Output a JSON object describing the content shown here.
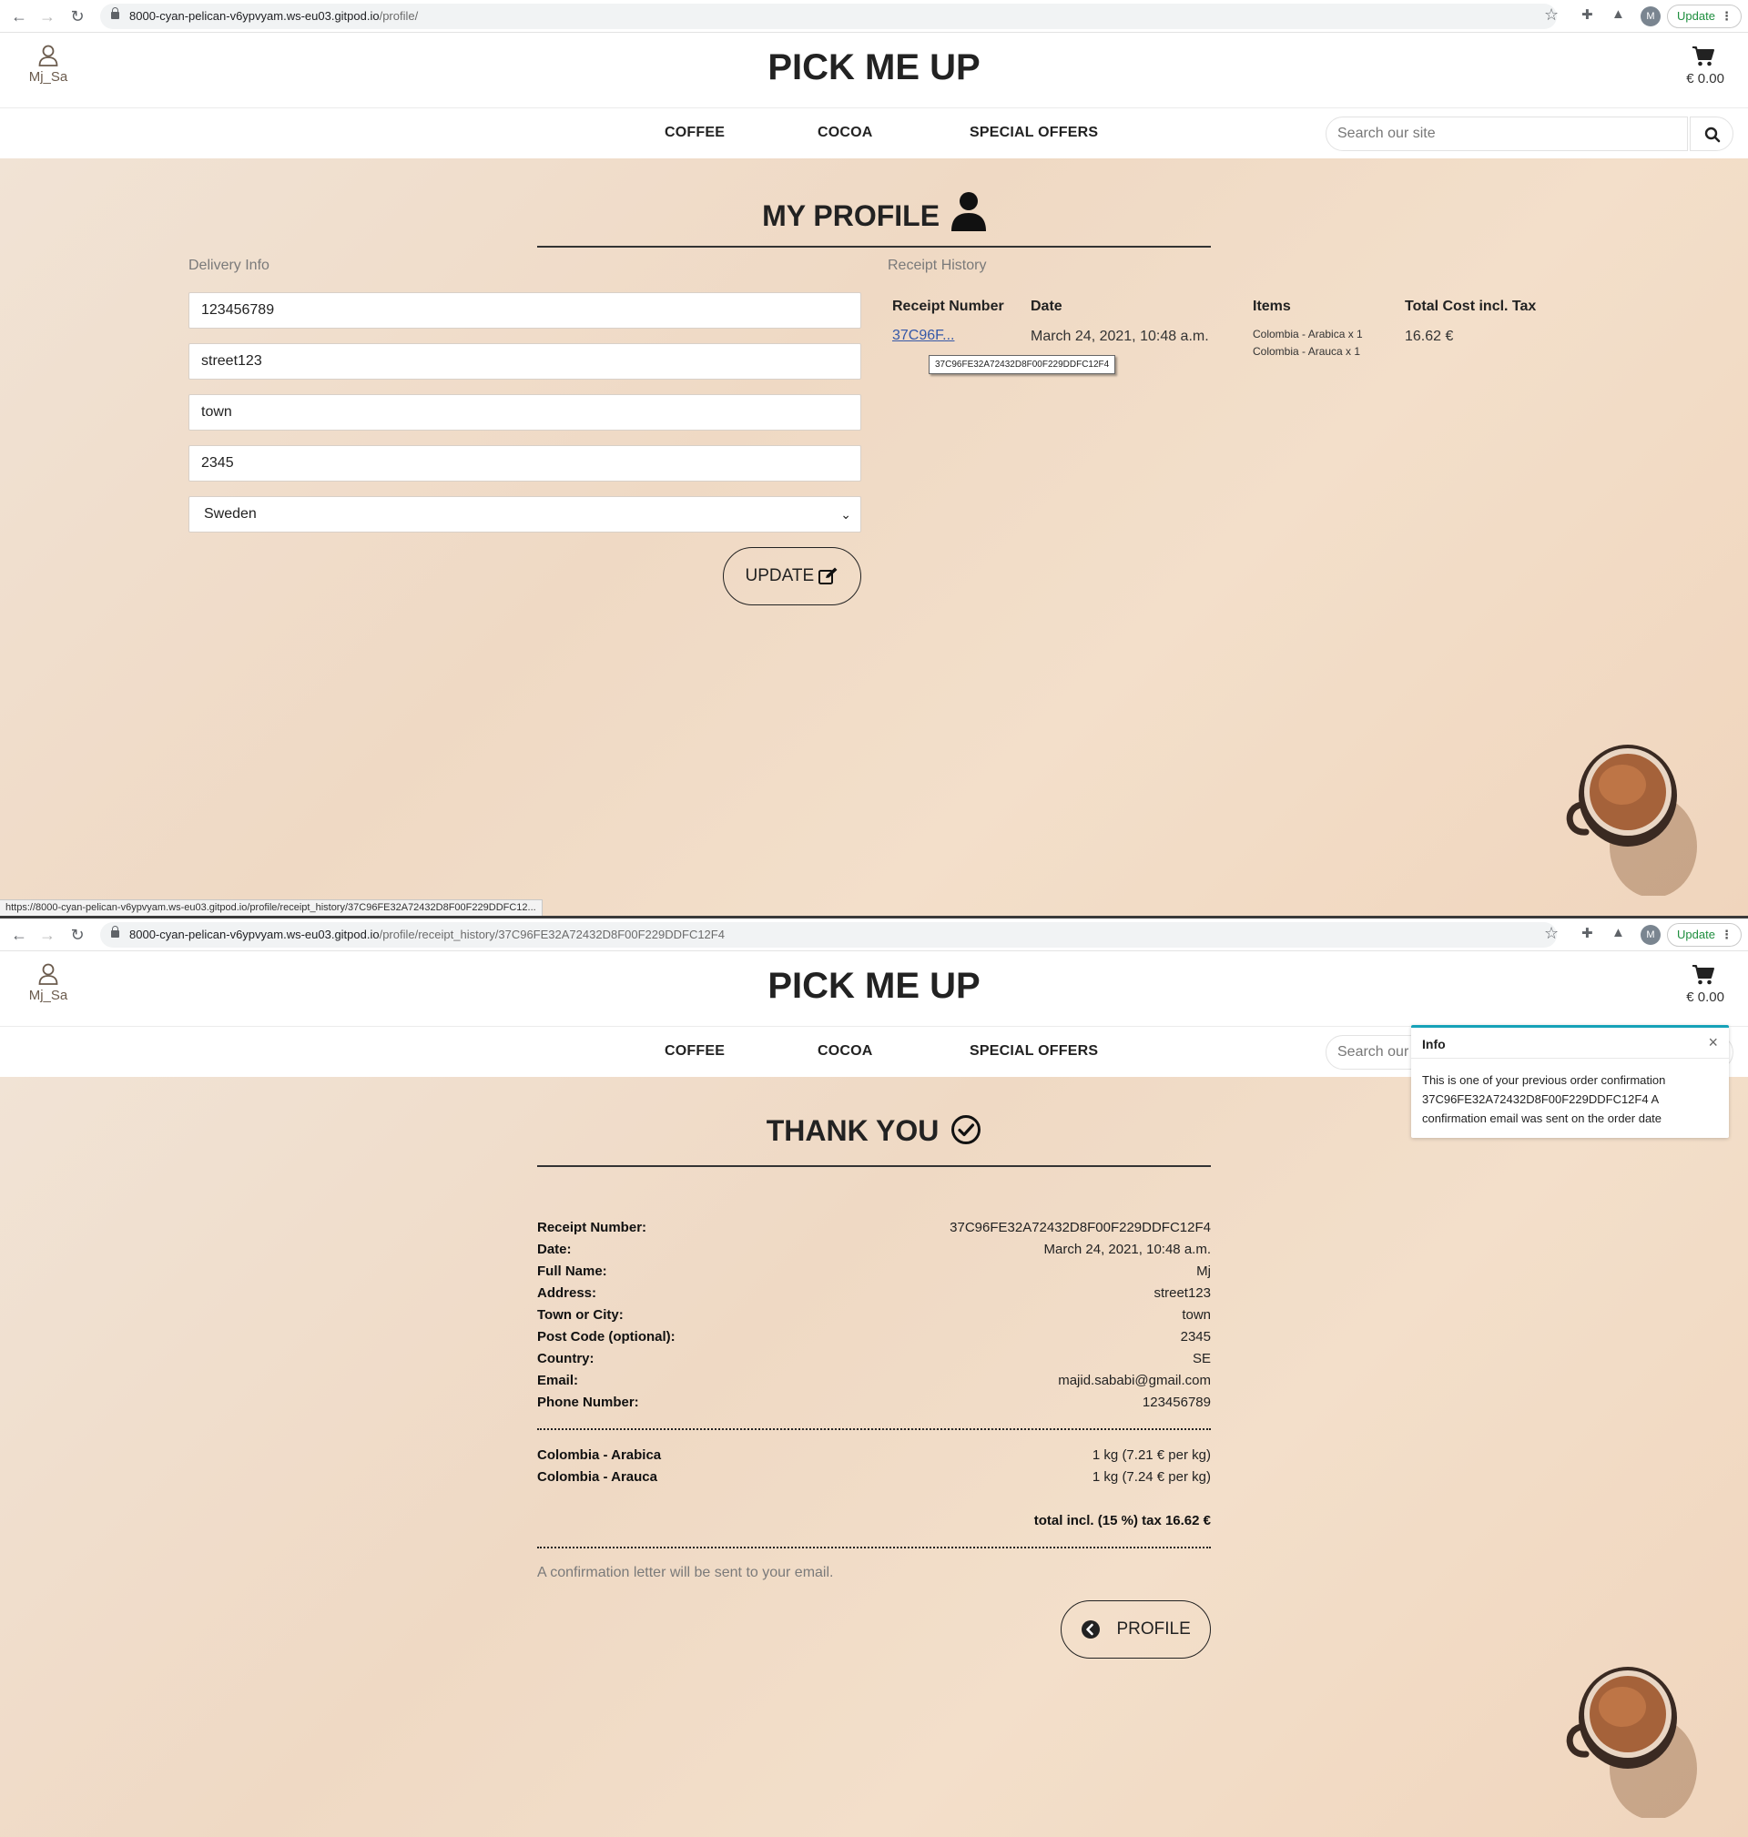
{
  "profile_screen": {
    "browser": {
      "url_host": "8000-cyan-pelican-v6ypvyam.ws-eu03.gitpod.io",
      "url_path": "/profile/",
      "avatar_letter": "M",
      "update_label": "Update"
    },
    "header": {
      "user_name": "Mj_Sa",
      "logo": "PICK ME UP",
      "cart_total": "€ 0.00"
    },
    "menu": {
      "coffee": "COFFEE",
      "cocoa": "COCOA",
      "special_offers": "SPECIAL OFFERS",
      "search_placeholder": "Search our site"
    },
    "title": "MY PROFILE",
    "delivery": {
      "label": "Delivery Info",
      "phone": "123456789",
      "street": "street123",
      "town": "town",
      "postcode": "2345",
      "country": "Sweden",
      "update_button": "UPDATE"
    },
    "receipt_history": {
      "label": "Receipt History",
      "headers": {
        "receipt_number": "Receipt Number",
        "date": "Date",
        "items": "Items",
        "total": "Total Cost incl. Tax"
      },
      "row": {
        "receipt_short": "37C96F...",
        "receipt_full": "37C96FE32A72432D8F00F229DDFC12F4",
        "date": "March 24, 2021, 10:48 a.m.",
        "item_1": "Colombia - Arabica x 1",
        "item_2": "Colombia - Arauca x 1",
        "total": "16.62 €"
      }
    },
    "status_url": "https://8000-cyan-pelican-v6ypvyam.ws-eu03.gitpod.io/profile/receipt_history/37C96FE32A72432D8F00F229DDFC12..."
  },
  "receipt_screen": {
    "browser": {
      "url_host": "8000-cyan-pelican-v6ypvyam.ws-eu03.gitpod.io",
      "url_path": "/profile/receipt_history/37C96FE32A72432D8F00F229DDFC12F4",
      "avatar_letter": "M",
      "update_label": "Update"
    },
    "header": {
      "user_name": "Mj_Sa",
      "logo": "PICK ME UP",
      "cart_total": "€ 0.00"
    },
    "menu": {
      "coffee": "COFFEE",
      "cocoa": "COCOA",
      "special_offers": "SPECIAL OFFERS",
      "search_placeholder": "Search our site"
    },
    "toast": {
      "title": "Info",
      "body": "This is one of your previous order confirmation 37C96FE32A72432D8F00F229DDFC12F4 A confirmation email was sent on the order date"
    },
    "title": "THANK YOU",
    "details": [
      {
        "label": "Receipt Number:",
        "value": "37C96FE32A72432D8F00F229DDFC12F4"
      },
      {
        "label": "Date:",
        "value": "March 24, 2021, 10:48 a.m."
      },
      {
        "label": "Full Name:",
        "value": "Mj"
      },
      {
        "label": "Address:",
        "value": "street123"
      },
      {
        "label": "Town or City:",
        "value": "town"
      },
      {
        "label": "Post Code (optional):",
        "value": "2345"
      },
      {
        "label": "Country:",
        "value": "SE"
      },
      {
        "label": "Email:",
        "value": "majid.sababi@gmail.com"
      },
      {
        "label": "Phone Number:",
        "value": "123456789"
      }
    ],
    "items": [
      {
        "name": "Colombia - Arabica",
        "qty": "1 kg (7.21 € per kg)"
      },
      {
        "name": "Colombia - Arauca",
        "qty": "1 kg (7.24 € per kg)"
      }
    ],
    "total_line": "total incl. (15 %) tax 16.62 €",
    "note": "A confirmation letter will be sent to your email.",
    "profile_button": "PROFILE"
  },
  "colors": {
    "page_background": "#efd9c4",
    "link": "#3558a8",
    "toast_accent": "#17a2b8",
    "update_green": "#1e8e3e"
  }
}
